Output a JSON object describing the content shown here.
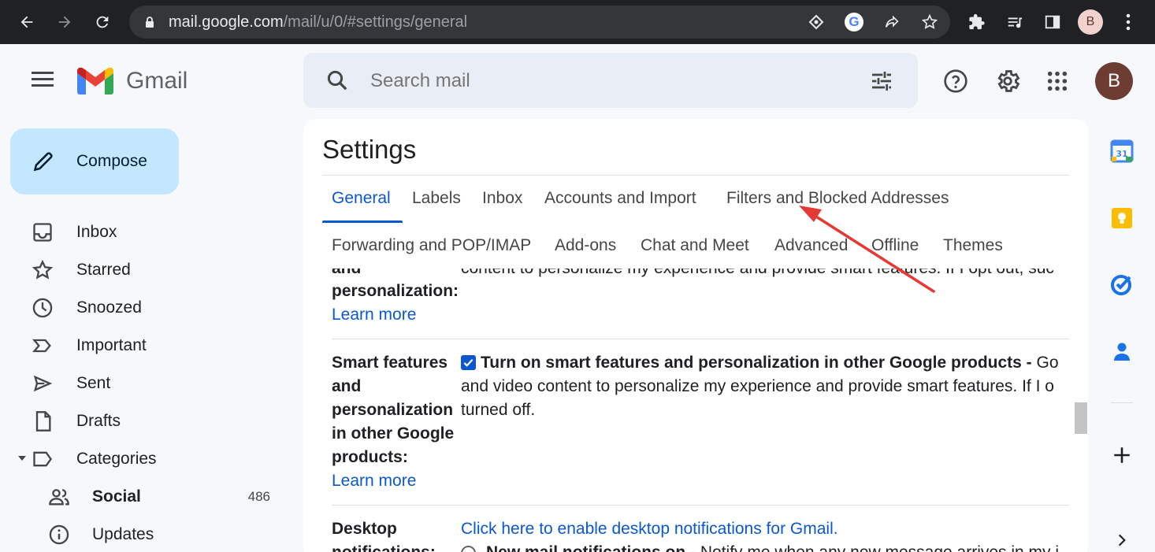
{
  "browser": {
    "url_host": "mail.google.com",
    "url_path": "/mail/u/0/#settings/general",
    "profile_initial": "B"
  },
  "header": {
    "app_name": "Gmail",
    "search_placeholder": "Search mail",
    "avatar_initial": "B"
  },
  "sidebar": {
    "compose_label": "Compose",
    "items": [
      {
        "label": "Inbox",
        "icon": "inbox-icon"
      },
      {
        "label": "Starred",
        "icon": "star-icon"
      },
      {
        "label": "Snoozed",
        "icon": "clock-icon"
      },
      {
        "label": "Important",
        "icon": "important-icon"
      },
      {
        "label": "Sent",
        "icon": "send-icon"
      },
      {
        "label": "Drafts",
        "icon": "draft-icon"
      },
      {
        "label": "Categories",
        "icon": "label-icon"
      }
    ],
    "categories": [
      {
        "label": "Social",
        "count": "486",
        "icon": "people-icon"
      },
      {
        "label": "Updates",
        "icon": "info-icon"
      }
    ]
  },
  "settings": {
    "title": "Settings",
    "tabs_row1": [
      "General",
      "Labels",
      "Inbox",
      "Accounts and Import",
      "Filters and Blocked Addresses"
    ],
    "tabs_row2": [
      "Forwarding and POP/IMAP",
      "Add-ons",
      "Chat and Meet",
      "Advanced",
      "Offline",
      "Themes"
    ],
    "active_tab": "General",
    "row1": {
      "label_line1": "and",
      "label_line2": "personalization:",
      "desc_line1": "content to personalize my experience and provide smart features. If I opt out, suc",
      "learn_more": "Learn more"
    },
    "row2": {
      "label_lines": [
        "Smart features",
        "and",
        "personalization",
        "in other Google",
        "products:"
      ],
      "checkbox_checked": true,
      "checkbox_label": "Turn on smart features and personalization in other Google products -",
      "desc_line1_tail": "Go",
      "desc_line2": "and video content to personalize my experience and provide smart features. If I o",
      "desc_line3": "turned off.",
      "learn_more": "Learn more"
    },
    "row3": {
      "label_line1": "Desktop",
      "label_line2": "notifications:",
      "link": "Click here to enable desktop notifications for Gmail.",
      "radio_label": "New mail notifications on -",
      "radio_desc": "Notify me when any new message arrives in my i"
    }
  },
  "colors": {
    "accent": "#0b57d0",
    "arrow": "#e53935"
  }
}
